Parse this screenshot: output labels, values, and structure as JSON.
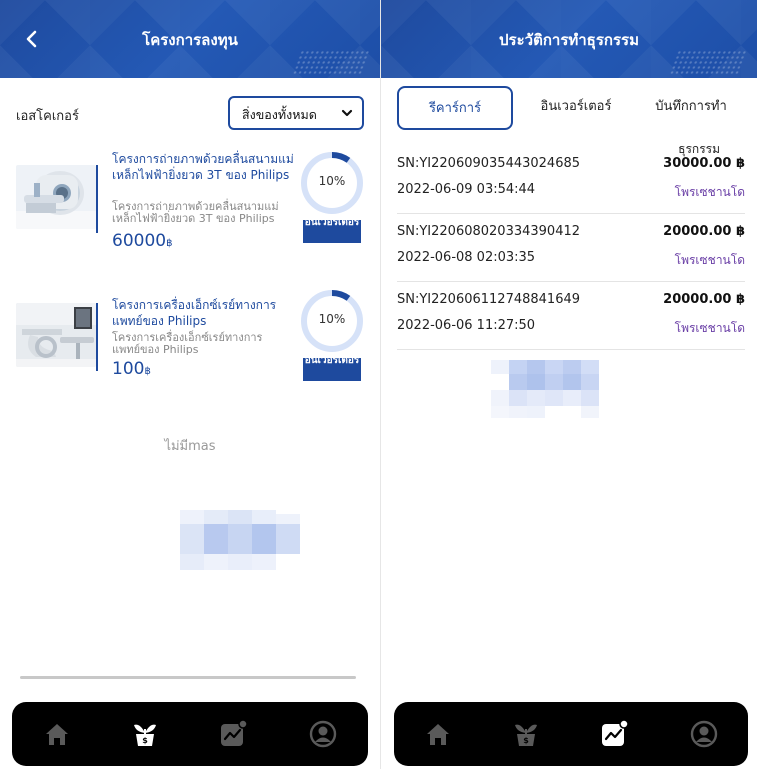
{
  "left": {
    "header_title": "โครงการลงทุน",
    "filter_label": "เอสโคเกอร์",
    "filter_value": "สิ่งของทั้งหมด",
    "projects": [
      {
        "title": "โครงการถ่ายภาพด้วยคลื่นสนามแม่เหล็กไฟฟ้ายิ่งยวด 3T ของ Philips",
        "subtitle": "โครงการถ่ายภาพด้วยคลื่นสนามแม่เหล็กไฟฟ้ายิ่งยวด 3T ของ Philips",
        "amount": "60000",
        "currency": "฿",
        "progress_label": "10%",
        "progress": 0.1,
        "button_label": "อินเวอร์เตอร์"
      },
      {
        "title": "โครงการเครื่องเอ็กซ์เรย์ทางการแพทย์ของ Philips",
        "subtitle": "โครงการเครื่องเอ็กซ์เรย์ทางการแพทย์ของ Philips",
        "amount": "100",
        "currency": "฿",
        "progress_label": "10%",
        "progress": 0.1,
        "button_label": "อินเวอร์เตอร์"
      }
    ],
    "no_more_text": "ไม่มีmas"
  },
  "right": {
    "header_title": "ประวัติการทำธุรกรรม",
    "tabs": [
      {
        "label": "รีคาร์การ์",
        "active": true
      },
      {
        "label": "อินเวอร์เตอร์",
        "active": false
      },
      {
        "label": "บันทึกการทำ",
        "active": false
      }
    ],
    "column_header": "ธุรกรรม",
    "transactions": [
      {
        "sn": "SN:YI220609035443024685",
        "amount": "30000.00 ฿",
        "time": "2022-06-09 03:54:44",
        "type": "โพรเซชานโด"
      },
      {
        "sn": "SN:YI220608020334390412",
        "amount": "20000.00 ฿",
        "time": "2022-06-08 02:03:35",
        "type": "โพรเซชานโด"
      },
      {
        "sn": "SN:YI220606112748841649",
        "amount": "20000.00 ฿",
        "time": "2022-06-06 11:27:50",
        "type": "โพรเซชานโด"
      }
    ]
  },
  "nav_icons": [
    "home-icon",
    "plant-icon",
    "chart-icon",
    "user-icon"
  ],
  "colors": {
    "primary": "#1e4a9e",
    "nav_bg": "#000000",
    "nav_icon": "#5a5a5a",
    "nav_icon_active": "#ffffff",
    "type_text": "#6a3fa6"
  }
}
